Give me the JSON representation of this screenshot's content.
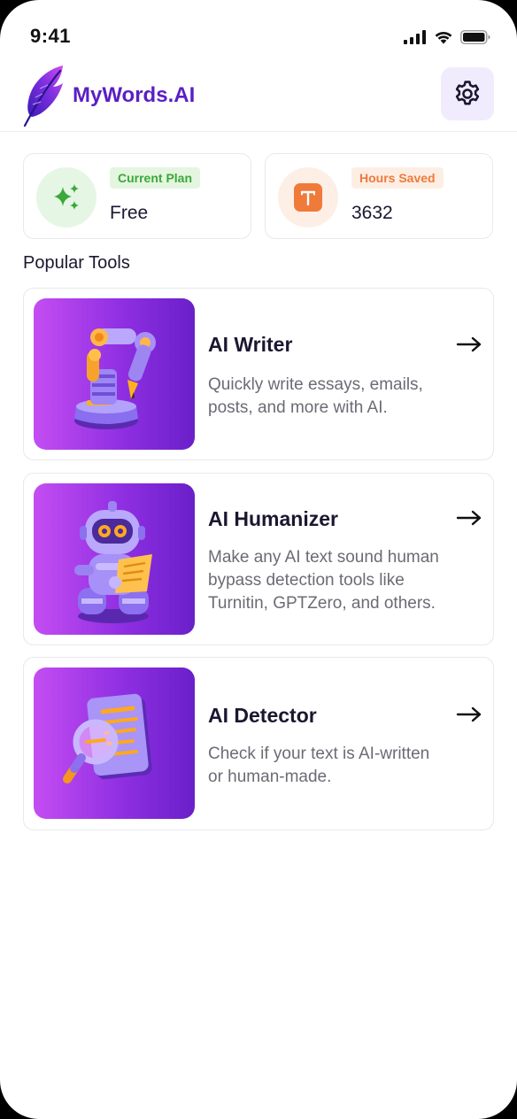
{
  "status_bar": {
    "time": "9:41"
  },
  "header": {
    "app_name": "MyWords.AI",
    "logo_icon": "feather-icon",
    "settings_icon": "gear-icon"
  },
  "stats": {
    "plan": {
      "label": "Current Plan",
      "value": "Free",
      "icon": "sparkles-icon"
    },
    "hours": {
      "label": "Hours Saved",
      "value": "3632",
      "icon": "text-t-icon"
    }
  },
  "section": {
    "title": "Popular Tools"
  },
  "tools": [
    {
      "title": "AI Writer",
      "desc_lines": [
        "Quickly write essays, emails,",
        "posts, and more with AI."
      ],
      "icon": "robot-arm-pen-icon"
    },
    {
      "title": "AI Humanizer",
      "desc_lines": [
        "Make any AI text sound human",
        "bypass detection tools like",
        "Turnitin, GPTZero, and others."
      ],
      "icon": "robot-reading-icon"
    },
    {
      "title": "AI Detector",
      "desc_lines": [
        "Check if your text is AI-written",
        "or human-made."
      ],
      "icon": "magnifier-document-icon"
    }
  ],
  "colors": {
    "brand": "#5a1fc4",
    "plan_accent": "#3aa83a",
    "hours_accent": "#ee7a3c",
    "settings_bg": "#f1ecfd"
  }
}
